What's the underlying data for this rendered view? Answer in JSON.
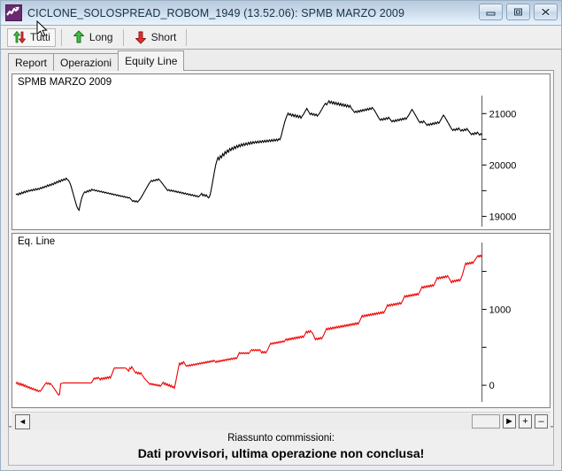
{
  "window": {
    "title": "CICLONE_SOLOSPREAD_ROBOM_1949 (13.52.06): SPMB MARZO 2009",
    "icon": "chart-line-icon",
    "buttons": {
      "minimize": "minimize-icon",
      "restore": "restore-icon",
      "close": "close-icon"
    }
  },
  "toolbar": {
    "items": [
      {
        "label": "Tutti",
        "icon": "up-down-arrows-icon",
        "pressed": true
      },
      {
        "label": "Long",
        "icon": "green-up-arrow-icon",
        "pressed": false
      },
      {
        "label": "Short",
        "icon": "red-down-arrow-icon",
        "pressed": false
      }
    ]
  },
  "tabs": [
    {
      "label": "Report",
      "active": false
    },
    {
      "label": "Operazioni",
      "active": false
    },
    {
      "label": "Equity Line",
      "active": true
    }
  ],
  "scrollbar": {
    "left_arrow": "◄",
    "right_arrow": "►",
    "zoom_in": "+",
    "zoom_out": "–"
  },
  "status": {
    "line1": "Riassunto commissioni:",
    "line2": "Dati provvisori, ultima operazione non conclusa!"
  },
  "colors": {
    "price_line": "#000000",
    "equity_line": "#ee0000",
    "titlebar_start": "#b9cbdd",
    "titlebar_end": "#e8f2fb",
    "panel_bg": "#ffffff",
    "window_bg": "#ececed"
  },
  "chart_data": [
    {
      "type": "line",
      "name": "price-chart",
      "title": "SPMB MARZO 2009",
      "xlabel": "",
      "ylabel": "",
      "ylim": [
        18800,
        21350
      ],
      "yticks": [
        19000,
        19500,
        20000,
        20500,
        21000
      ],
      "ytick_labels": [
        "19000",
        "",
        "20000",
        "",
        "21000"
      ],
      "grid": false,
      "legend": "none",
      "axis_side": "right",
      "color": "#000000",
      "values": [
        19420,
        19440,
        19415,
        19455,
        19430,
        19470,
        19445,
        19485,
        19460,
        19500,
        19475,
        19510,
        19490,
        19520,
        19495,
        19530,
        19505,
        19540,
        19515,
        19545,
        19525,
        19560,
        19540,
        19575,
        19555,
        19590,
        19570,
        19610,
        19585,
        19625,
        19600,
        19640,
        19615,
        19660,
        19635,
        19680,
        19655,
        19700,
        19670,
        19715,
        19690,
        19730,
        19705,
        19745,
        19715,
        19700,
        19660,
        19600,
        19520,
        19440,
        19360,
        19280,
        19200,
        19150,
        19120,
        19230,
        19330,
        19400,
        19450,
        19480,
        19460,
        19500,
        19475,
        19515,
        19490,
        19530,
        19505,
        19520,
        19495,
        19510,
        19485,
        19500,
        19475,
        19490,
        19465,
        19480,
        19455,
        19470,
        19445,
        19460,
        19435,
        19450,
        19425,
        19440,
        19415,
        19430,
        19405,
        19420,
        19395,
        19410,
        19385,
        19400,
        19375,
        19390,
        19365,
        19380,
        19355,
        19370,
        19345,
        19320,
        19290,
        19310,
        19280,
        19305,
        19275,
        19300,
        19330,
        19360,
        19400,
        19440,
        19480,
        19520,
        19560,
        19600,
        19640,
        19670,
        19700,
        19680,
        19710,
        19690,
        19720,
        19700,
        19730,
        19705,
        19680,
        19650,
        19620,
        19590,
        19560,
        19530,
        19500,
        19520,
        19490,
        19515,
        19485,
        19505,
        19475,
        19495,
        19465,
        19485,
        19455,
        19475,
        19445,
        19465,
        19435,
        19455,
        19425,
        19445,
        19415,
        19435,
        19405,
        19425,
        19395,
        19415,
        19385,
        19405,
        19375,
        19395,
        19420,
        19450,
        19400,
        19430,
        19390,
        19420,
        19380,
        19360,
        19400,
        19500,
        19620,
        19750,
        19880,
        20000,
        20080,
        20150,
        20100,
        20180,
        20140,
        20220,
        20180,
        20260,
        20220,
        20290,
        20250,
        20320,
        20280,
        20340,
        20300,
        20360,
        20320,
        20380,
        20340,
        20395,
        20355,
        20410,
        20370,
        20420,
        20380,
        20430,
        20390,
        20440,
        20400,
        20450,
        20410,
        20455,
        20420,
        20460,
        20425,
        20465,
        20430,
        20470,
        20435,
        20475,
        20440,
        20480,
        20445,
        20485,
        20450,
        20490,
        20455,
        20495,
        20460,
        20500,
        20465,
        20505,
        20470,
        20510,
        20490,
        20560,
        20650,
        20740,
        20830,
        20900,
        20960,
        21010,
        20970,
        21000,
        20950,
        20990,
        20940,
        20980,
        20930,
        20970,
        20920,
        20960,
        20910,
        20950,
        20980,
        21020,
        21060,
        21100,
        21060,
        21020,
        20980,
        21010,
        20970,
        21000,
        20960,
        20990,
        20950,
        20980,
        21010,
        21050,
        21090,
        21130,
        21170,
        21200,
        21170,
        21210,
        21250,
        21200,
        21240,
        21190,
        21230,
        21180,
        21220,
        21170,
        21210,
        21160,
        21200,
        21150,
        21190,
        21140,
        21180,
        21130,
        21170,
        21120,
        21160,
        21110,
        21080,
        21050,
        21020,
        21050,
        21020,
        21060,
        21030,
        21070,
        21040,
        21080,
        21050,
        21090,
        21060,
        21100,
        21070,
        21110,
        21080,
        21120,
        21090,
        21060,
        21020,
        20980,
        20940,
        20900,
        20870,
        20900,
        20870,
        20910,
        20880,
        20920,
        20890,
        20930,
        20900,
        20870,
        20840,
        20870,
        20840,
        20880,
        20850,
        20890,
        20860,
        20900,
        20870,
        20910,
        20880,
        20920,
        20890,
        20930,
        20960,
        21000,
        21040,
        21080,
        21050,
        21010,
        20970,
        20930,
        20890,
        20850,
        20820,
        20850,
        20820,
        20860,
        20830,
        20800,
        20770,
        20800,
        20770,
        20810,
        20780,
        20820,
        20790,
        20830,
        20800,
        20840,
        20810,
        20850,
        20890,
        20930,
        20970,
        20940,
        20900,
        20860,
        20820,
        20780,
        20740,
        20700,
        20670,
        20700,
        20670,
        20710,
        20680,
        20720,
        20690,
        20660,
        20690,
        20660,
        20700,
        20670,
        20710,
        20680,
        20650,
        20620,
        20590,
        20620,
        20590,
        20630,
        20600,
        20640,
        20610,
        20580,
        20610,
        20580
      ]
    },
    {
      "type": "line",
      "name": "equity-line-chart",
      "title": "Eq. Line",
      "xlabel": "",
      "ylabel": "",
      "ylim": [
        -220,
        1880
      ],
      "yticks": [
        0,
        500,
        1000,
        1500
      ],
      "ytick_labels": [
        "0",
        "",
        "1000",
        ""
      ],
      "grid": false,
      "legend": "none",
      "axis_side": "right",
      "color": "#ee0000",
      "values": [
        20,
        40,
        10,
        30,
        0,
        25,
        -5,
        15,
        -15,
        5,
        -25,
        -10,
        -35,
        -20,
        -45,
        -30,
        -55,
        -40,
        -65,
        -50,
        -75,
        -60,
        -85,
        -70,
        -80,
        -60,
        -40,
        -20,
        0,
        20,
        35,
        15,
        30,
        10,
        25,
        5,
        -10,
        -30,
        -50,
        -70,
        -90,
        -110,
        -130,
        -120,
        20,
        25,
        28,
        30,
        30,
        30,
        30,
        30,
        30,
        30,
        30,
        30,
        30,
        30,
        30,
        30,
        30,
        30,
        30,
        30,
        30,
        30,
        30,
        30,
        30,
        30,
        30,
        30,
        30,
        30,
        30,
        45,
        70,
        95,
        80,
        100,
        85,
        105,
        90,
        70,
        95,
        75,
        100,
        80,
        105,
        85,
        110,
        90,
        115,
        95,
        130,
        160,
        200,
        230,
        225,
        230,
        225,
        230,
        225,
        230,
        225,
        230,
        225,
        230,
        225,
        215,
        200,
        185,
        230,
        215,
        245,
        225,
        200,
        180,
        160,
        175,
        150,
        170,
        145,
        165,
        140,
        120,
        100,
        85,
        70,
        55,
        40,
        25,
        10,
        25,
        5,
        20,
        0,
        15,
        -5,
        10,
        -10,
        5,
        -15,
        0,
        20,
        40,
        10,
        30,
        0,
        20,
        -10,
        10,
        -20,
        0,
        -30,
        -15,
        -40,
        20,
        90,
        160,
        230,
        290,
        270,
        300,
        280,
        310,
        290,
        265,
        250,
        265,
        250,
        270,
        255,
        275,
        260,
        280,
        265,
        285,
        270,
        290,
        275,
        295,
        280,
        300,
        285,
        305,
        290,
        310,
        295,
        315,
        300,
        320,
        305,
        325,
        310,
        330,
        315,
        300,
        320,
        305,
        325,
        310,
        330,
        315,
        335,
        320,
        340,
        325,
        345,
        330,
        350,
        335,
        355,
        340,
        360,
        345,
        365,
        350,
        370,
        400,
        430,
        415,
        430,
        415,
        430,
        415,
        430,
        415,
        430,
        415,
        430,
        450,
        470,
        455,
        470,
        455,
        470,
        455,
        470,
        455,
        470,
        455,
        425,
        445,
        425,
        445,
        425,
        445,
        470,
        500,
        530,
        555,
        540,
        560,
        545,
        565,
        550,
        570,
        555,
        575,
        560,
        580,
        565,
        585,
        570,
        590,
        610,
        590,
        615,
        595,
        620,
        600,
        625,
        605,
        630,
        610,
        635,
        615,
        640,
        620,
        645,
        625,
        650,
        630,
        655,
        680,
        710,
        690,
        715,
        695,
        720,
        700,
        690,
        660,
        630,
        600,
        620,
        600,
        625,
        605,
        630,
        610,
        635,
        660,
        690,
        720,
        750,
        730,
        755,
        735,
        760,
        740,
        765,
        745,
        770,
        750,
        775,
        755,
        780,
        760,
        785,
        765,
        790,
        770,
        795,
        775,
        800,
        780,
        805,
        785,
        810,
        790,
        815,
        795,
        820,
        800,
        825,
        805,
        830,
        860,
        890,
        920,
        900,
        925,
        905,
        930,
        910,
        935,
        915,
        940,
        920,
        945,
        925,
        950,
        930,
        955,
        935,
        960,
        940,
        965,
        945,
        970,
        950,
        975,
        1000,
        1030,
        1060,
        1040,
        1065,
        1045,
        1070,
        1050,
        1075,
        1055,
        1080,
        1060,
        1085,
        1065,
        1090,
        1070,
        1095,
        1120,
        1150,
        1180,
        1160,
        1185,
        1165,
        1190,
        1170,
        1195,
        1175,
        1200,
        1180,
        1205,
        1185,
        1210,
        1190,
        1215,
        1240,
        1270,
        1300,
        1280,
        1305,
        1285,
        1310,
        1290,
        1315,
        1295,
        1320,
        1300,
        1325,
        1305,
        1330,
        1360,
        1390,
        1420,
        1400,
        1425,
        1405,
        1430,
        1410,
        1435,
        1415,
        1440,
        1420,
        1445,
        1425,
        1400,
        1375,
        1350,
        1380,
        1360,
        1385,
        1365,
        1390,
        1370,
        1395,
        1375,
        1400,
        1430,
        1470,
        1520,
        1570,
        1610,
        1590,
        1615,
        1595,
        1620,
        1600,
        1625,
        1605,
        1630,
        1650,
        1670,
        1690,
        1710,
        1690,
        1715,
        1695,
        1720
      ]
    }
  ],
  "cursor": {
    "type": "arrow-cursor"
  }
}
